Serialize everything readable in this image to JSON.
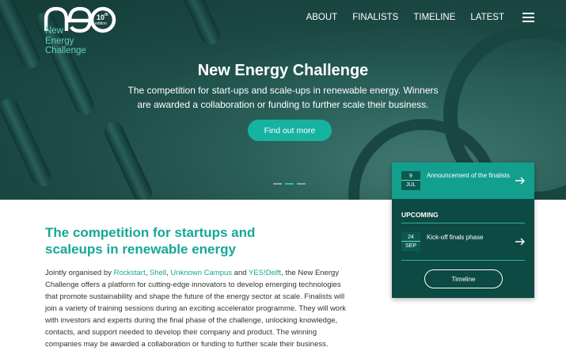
{
  "logo": {
    "mark": "nec",
    "edition_num": "10",
    "edition_suffix": "th",
    "edition_label": "edition",
    "line1": "New",
    "line2": "Energy",
    "line3": "Challenge"
  },
  "nav": {
    "items": [
      "ABOUT",
      "FINALISTS",
      "TIMELINE",
      "LATEST"
    ]
  },
  "hero": {
    "title": "New Energy Challenge",
    "subtitle": "The competition for start-ups and scale-ups in renewable energy. Winners are awarded a collaboration or funding to further scale their business.",
    "cta_label": "Find out more",
    "carousel_active": 2,
    "carousel_count": 3
  },
  "events": {
    "featured": {
      "day": "9",
      "month": "JUL",
      "title": "Announcement of the finalists"
    },
    "upcoming_label": "UPCOMING",
    "upcoming": {
      "day": "24",
      "month": "SEP",
      "title": "Kick-off finals phase"
    },
    "timeline_label": "Timeline"
  },
  "intro": {
    "heading": "The competition for startups and scaleups in renewable energy",
    "p_start": "Jointly organised by ",
    "link1": "Rockstart",
    "sep1": ", ",
    "link2": "Shell",
    "sep2": ", ",
    "link3": "Unknown Campus",
    "sep3": " and ",
    "link4": "YES!Delft",
    "p_rest": ", the New Energy Challenge offers a platform for cutting-edge innovators to develop emerging technologies that promote sustainability and shape the future of the energy sector at scale. Finalists will join a variety of training sessions during an exciting accelerator programme. They will work with investors and experts during the final phase of the challenge, unlocking knowledge, contacts, and support needed to develop their company and product. The winning companies may be awarded a collaboration or funding to further scale their business."
  },
  "colors": {
    "accent": "#16a796",
    "panel": "#0d4a43",
    "panel_highlight": "#129f8e",
    "cta": "#17b3a1"
  }
}
